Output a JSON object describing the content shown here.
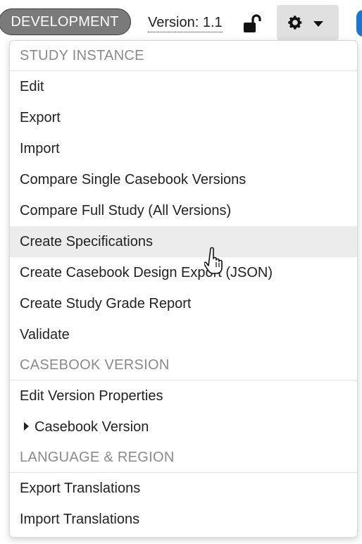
{
  "header": {
    "environment_badge": "DEVELOPMENT",
    "version_label": "Version: 1.1",
    "lock_icon": "unlocked-padlock-icon",
    "settings_icon": "gear-icon",
    "dropdown_icon": "caret-down-icon"
  },
  "menu": {
    "sections": [
      {
        "title": "STUDY INSTANCE",
        "items": [
          {
            "label": "Edit"
          },
          {
            "label": "Export"
          },
          {
            "label": "Import"
          },
          {
            "label": "Compare Single Casebook Versions"
          },
          {
            "label": "Compare Full Study (All Versions)"
          },
          {
            "label": "Create Specifications",
            "state": "hovered"
          },
          {
            "label": "Create Casebook Design Export (JSON)"
          },
          {
            "label": "Create Study Grade Report"
          },
          {
            "label": "Validate"
          }
        ]
      },
      {
        "title": "CASEBOOK VERSION",
        "items": [
          {
            "label": "Edit Version Properties"
          },
          {
            "label": "Casebook Version",
            "submenu": true
          }
        ]
      },
      {
        "title": "LANGUAGE & REGION",
        "items": [
          {
            "label": "Export Translations"
          },
          {
            "label": "Import Translations"
          }
        ]
      }
    ]
  },
  "colors": {
    "badge_bg": "#7a7a7a",
    "button_bg": "#e0e0e0",
    "highlight_bg": "#ececec",
    "section_text": "#8a8a8a"
  }
}
